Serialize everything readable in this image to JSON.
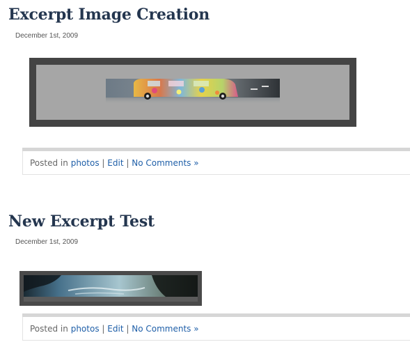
{
  "posts": [
    {
      "title": "Excerpt Image Creation",
      "date": "December 1st, 2009",
      "footer": {
        "posted_in": "Posted in",
        "category": "photos",
        "separator": "|",
        "edit": "Edit",
        "comments": "No Comments »"
      }
    },
    {
      "title": "New Excerpt Test",
      "date": "December 1st, 2009",
      "footer": {
        "posted_in": "Posted in",
        "category": "photos",
        "separator": "|",
        "edit": "Edit",
        "comments": "No Comments »"
      }
    }
  ],
  "colors": {
    "title": "#24364f",
    "link": "#1f5fa8",
    "frame_dark": "#444444",
    "frame_inner": "#a6a6a6"
  }
}
